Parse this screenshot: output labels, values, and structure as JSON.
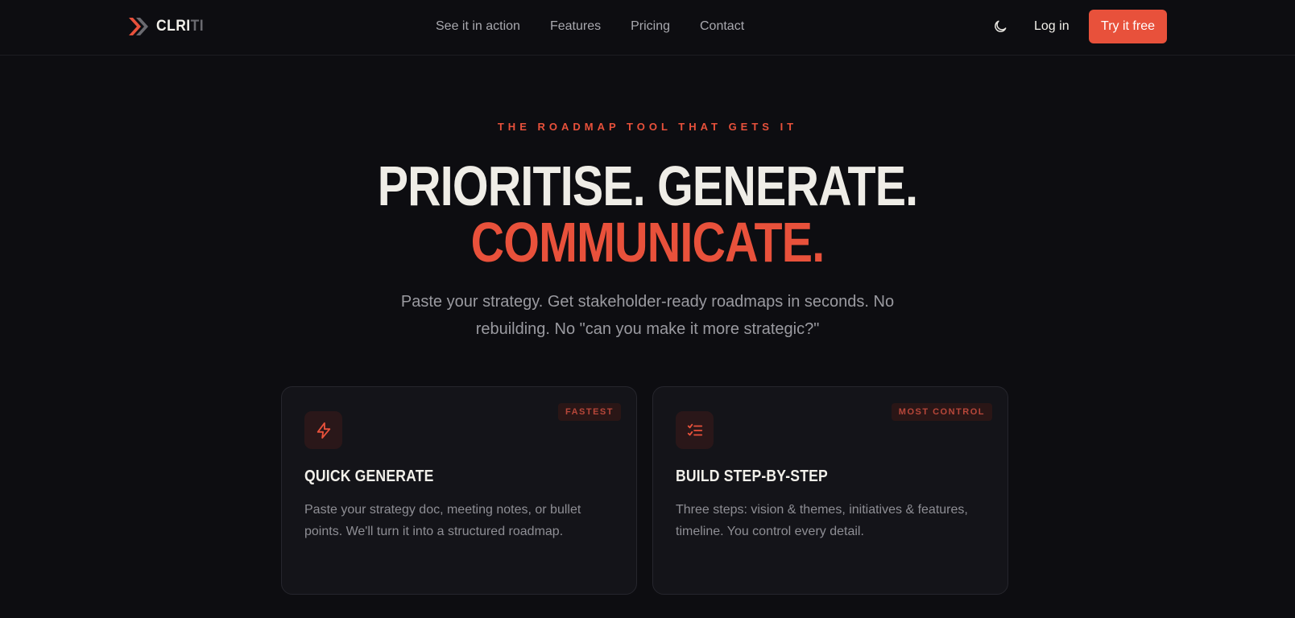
{
  "brand": {
    "name_bright": "CLRI",
    "name_dim": "TI",
    "accent": "#e8513b",
    "logo_icon": "double-chevron-icon"
  },
  "nav": {
    "links": [
      "See it in action",
      "Features",
      "Pricing",
      "Contact"
    ],
    "theme_icon": "moon-icon",
    "login_label": "Log in",
    "cta_label": "Try it free"
  },
  "hero": {
    "eyebrow": "THE ROADMAP TOOL THAT GETS IT",
    "headline_line1": "PRIORITISE. GENERATE.",
    "headline_line2": "COMMUNICATE.",
    "subtitle": "Paste your strategy. Get stakeholder-ready roadmaps in seconds. No rebuilding. No \"can you make it more strategic?\""
  },
  "cards": [
    {
      "badge": "FASTEST",
      "icon": "lightning-icon",
      "title": "QUICK GENERATE",
      "description": "Paste your strategy doc, meeting notes, or bullet points. We'll turn it into a structured roadmap."
    },
    {
      "badge": "MOST CONTROL",
      "icon": "checklist-icon",
      "title": "BUILD STEP-BY-STEP",
      "description": "Three steps: vision & themes, initiatives & features, timeline. You control every detail."
    }
  ]
}
